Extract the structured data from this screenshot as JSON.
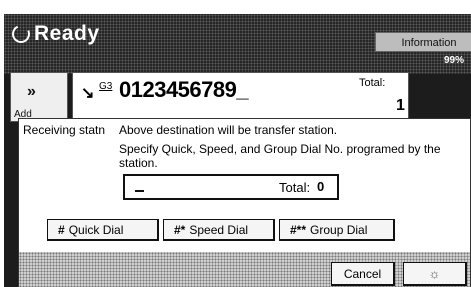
{
  "header": {
    "status_title": "Ready",
    "info_button_label": "Information",
    "percent_text": "99%"
  },
  "destination": {
    "add_button_arrow": "»",
    "add_button_label": "Add",
    "port_label": "G3",
    "fax_number": "0123456789_",
    "total_label": "Total:",
    "total_value": "1"
  },
  "dialog": {
    "title": "Receiving statn",
    "message_line1": "Above destination will be transfer station.",
    "message_line2": "Specify Quick, Speed, and Group Dial No. programed by the station.",
    "input": {
      "value": "_",
      "total_label": "Total:",
      "total_value": "0"
    },
    "dial_buttons": [
      {
        "glyph": "#",
        "label": "Quick Dial"
      },
      {
        "glyph": "#*",
        "label": "Speed Dial"
      },
      {
        "glyph": "#**",
        "label": "Group Dial"
      }
    ],
    "cancel_label": "Cancel",
    "ok_label": "☼"
  },
  "colors": {
    "screen_background": "#1c1c1c",
    "button_face": "#f5f5f5",
    "info_button": "#bdbdbd"
  },
  "icons": {
    "status": "ready-status-icon",
    "phone": "phone-icon"
  }
}
